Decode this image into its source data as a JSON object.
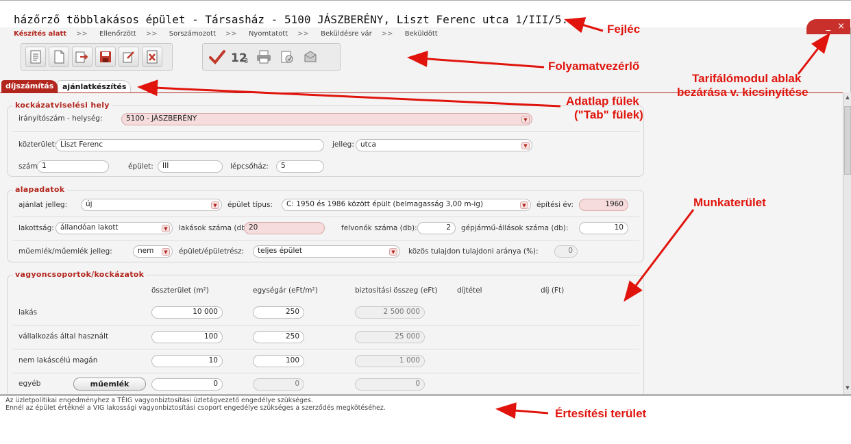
{
  "window": {
    "title": "házőrző többlakásos épület - Társasház - 5100 JÁSZBERÉNY,  Liszt Ferenc utca 1/III/5.",
    "minimize_label": "_",
    "close_label": "×"
  },
  "workflow": {
    "steps": [
      "Készítés alatt",
      "Ellenőrzött",
      "Sorszámozott",
      "Nyomtatott",
      "Beküldésre vár",
      "Beküldött"
    ],
    "separator": ">>"
  },
  "toolbar": {
    "group1": [
      "document-icon",
      "new-page-icon",
      "import-icon",
      "save-icon",
      "edit-export-icon",
      "excel-icon"
    ],
    "group2": [
      "checkmark-icon",
      "numbering-icon",
      "print-icon",
      "archive-icon",
      "send-icon"
    ]
  },
  "tabs": {
    "tab1": "díjszámítás",
    "tab2": "ajánlatkészítés"
  },
  "location": {
    "legend": "kockázatviselési hely",
    "zip_label": "irányítószám - helység:",
    "zip_value": "5100 - JÁSZBERÉNY",
    "street_label": "közterület:",
    "street_value": "Liszt Ferenc",
    "type_label": "jelleg:",
    "type_value": "utca",
    "number_label": "szám:",
    "number_value": "1",
    "building_label": "épület:",
    "building_value": "III",
    "stair_label": "lépcsőház:",
    "stair_value": "5"
  },
  "basics": {
    "legend": "alapadatok",
    "offer_type_label": "ajánlat jelleg:",
    "offer_type_value": "új",
    "building_type_label": "épület típus:",
    "building_type_value": "C: 1950 és 1986 között épült (belmagasság 3,00 m-ig)",
    "year_label": "építési év:",
    "year_value": "1960",
    "occupancy_label": "lakottság:",
    "occupancy_value": "állandóan lakott",
    "flats_label": "lakások száma (db):",
    "flats_value": "20",
    "elevators_label": "felvonók száma (db):",
    "elevators_value": "2",
    "parking_label": "gépjármű-állások száma (db):",
    "parking_value": "10",
    "monument_label": "műemlék/műemlék jelleg:",
    "monument_value": "nem",
    "part_label": "épület/épületrész:",
    "part_value": "teljes épület",
    "share_label": "közös tulajdon tulajdoni aránya (%):",
    "share_value": "0"
  },
  "assets": {
    "legend": "vagyoncsoportok/kockázatok",
    "headers": [
      "összterület (m²)",
      "egységár (eFt/m²)",
      "biztosítási összeg (eFt)",
      "díjtétel",
      "díj (Ft)"
    ],
    "rows": [
      {
        "name": "lakás",
        "area": "10 000",
        "unit": "250",
        "sum": "2 500 000"
      },
      {
        "name": "vállalkozás által használt",
        "area": "100",
        "unit": "250",
        "sum": "25 000"
      },
      {
        "name": "nem lakáscélú magán",
        "area": "10",
        "unit": "100",
        "sum": "1 000"
      },
      {
        "name": "egyéb",
        "area": "0",
        "unit": "0",
        "sum": "0"
      }
    ],
    "monument_button": "műemlék"
  },
  "notifications": [
    "Az üzletpolitikai engedményhez a TÉIG vagyonbiztosítási üzletágvezető engedélye szükséges.",
    "Ennél az épület értéknél a VIG lakossági vagyonbiztosítási csoport engedélye szükséges a szerződés megkötéséhez."
  ],
  "annotations": {
    "header": "Fejléc",
    "process": "Folyamatvezérlő",
    "close1": "Tarifálómodul ablak",
    "close2": "bezárása v. kicsinyítése",
    "tabs1": "Adatlap fülek",
    "tabs2": "(\"Tab\" fülek)",
    "work": "Munkaterület",
    "notify": "Értesítési terület"
  },
  "colors": {
    "accent": "#b3261e",
    "annotation": "#e0140c"
  }
}
